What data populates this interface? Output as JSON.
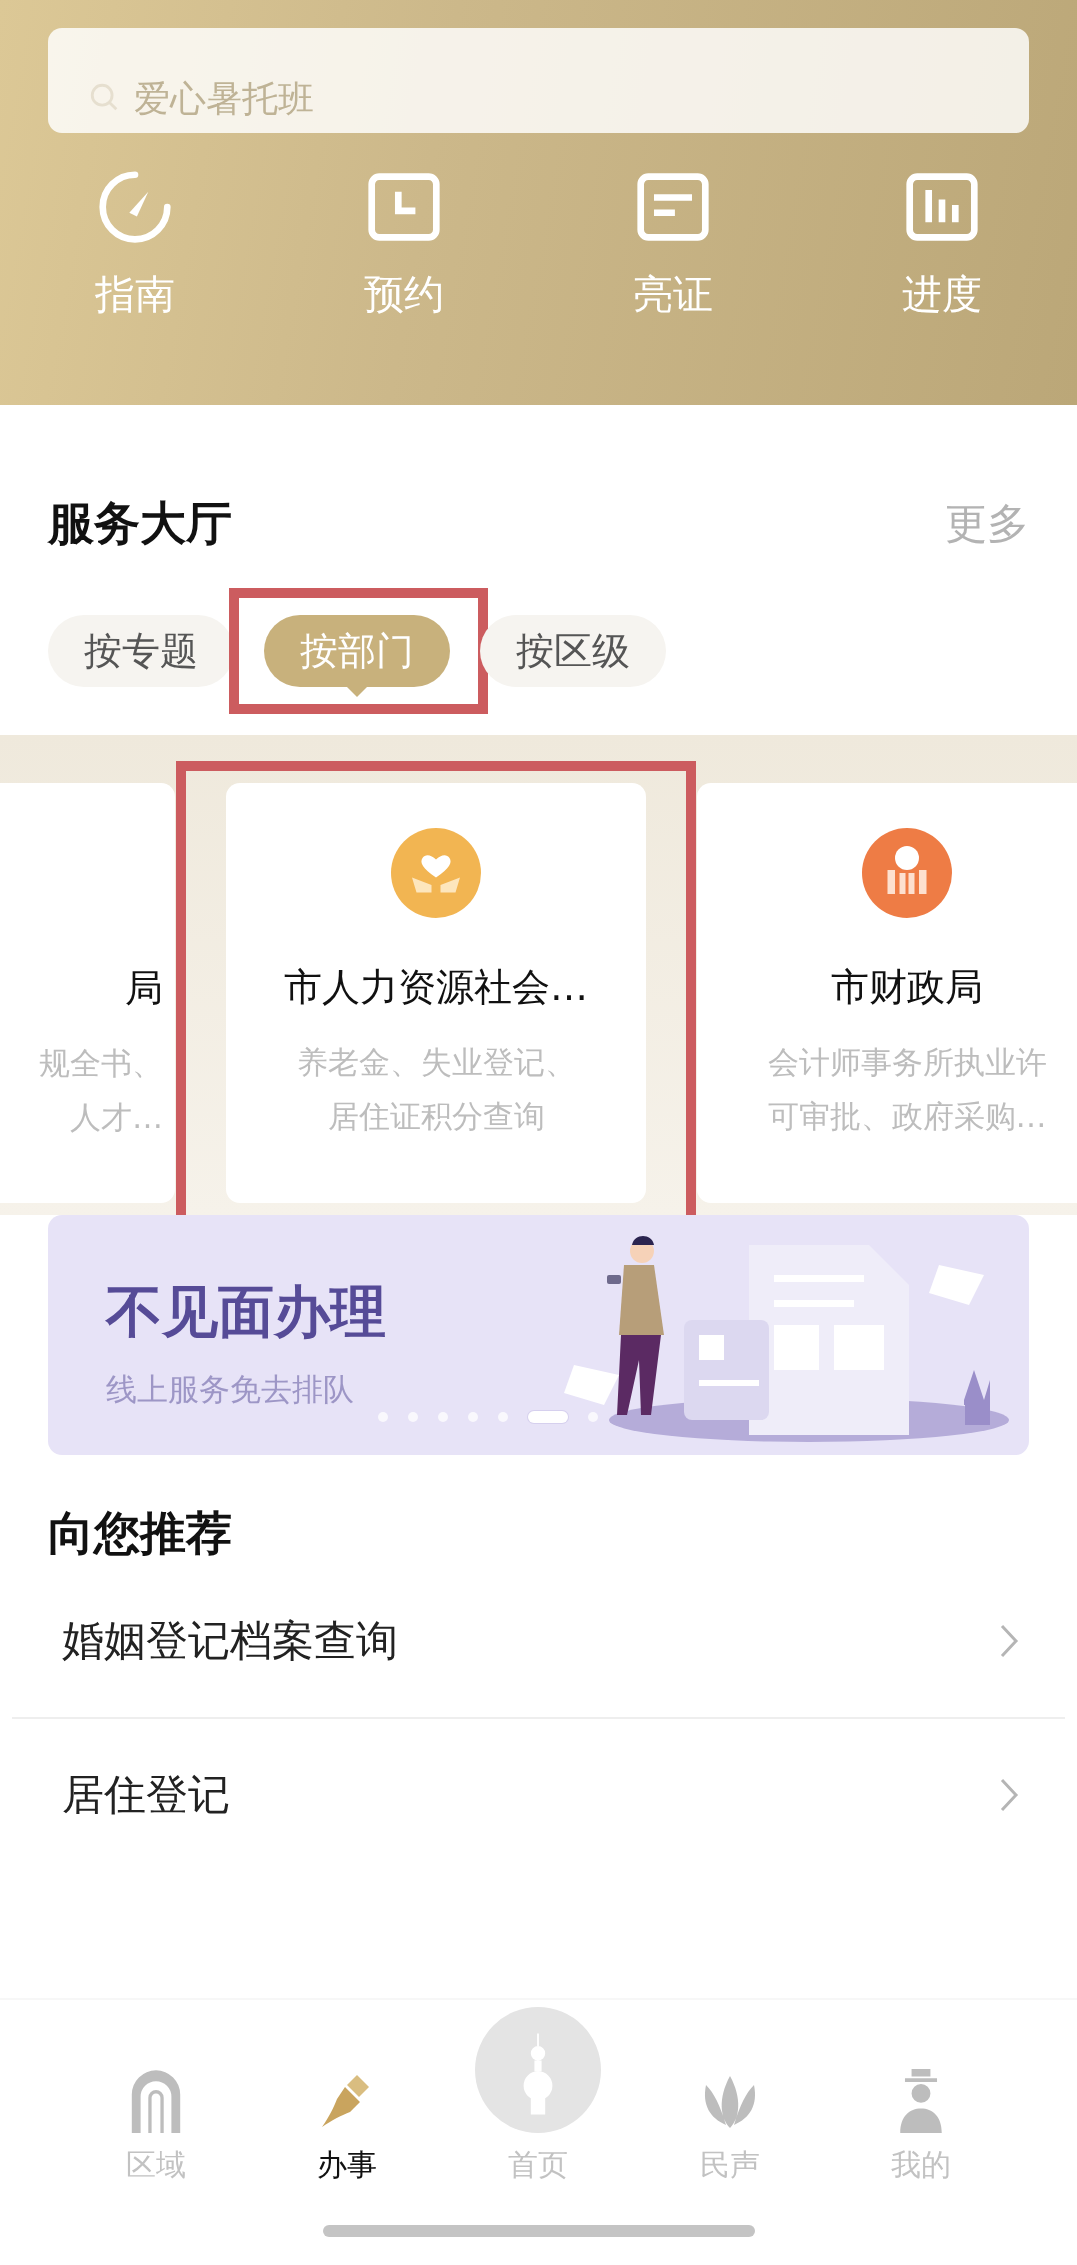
{
  "search": {
    "placeholder": "爱心暑托班"
  },
  "quick_actions": [
    {
      "kind": "gauge",
      "label": "指南"
    },
    {
      "kind": "clock",
      "label": "预约"
    },
    {
      "kind": "card",
      "label": "亮证"
    },
    {
      "kind": "chart",
      "label": "进度"
    }
  ],
  "service_hall": {
    "title": "服务大厅",
    "more": "更多",
    "tabs": [
      {
        "label": "按专题",
        "selected": false,
        "highlighted": false
      },
      {
        "label": "按部门",
        "selected": true,
        "highlighted": true
      },
      {
        "label": "按区级",
        "selected": false,
        "highlighted": false
      }
    ],
    "cards": [
      {
        "kind": "partial",
        "title": "局",
        "desc": [
          "规全书、",
          "人才…"
        ],
        "highlighted": false
      },
      {
        "kind": "heart",
        "title": "市人力资源社会…",
        "desc": [
          "养老金、失业登记、",
          "居住证积分查询"
        ],
        "highlighted": true
      },
      {
        "kind": "money",
        "title": "市财政局",
        "desc": [
          "会计师事务所执业许",
          "可审批、政府采购…"
        ],
        "highlighted": false
      }
    ]
  },
  "banner": {
    "title": "不见面办理",
    "subtitle": "线上服务免去排队",
    "dots": [
      {
        "selected": false
      },
      {
        "selected": false
      },
      {
        "selected": false
      },
      {
        "selected": false
      },
      {
        "selected": false
      },
      {
        "selected": true
      },
      {
        "selected": false
      }
    ]
  },
  "recommend": {
    "title": "向您推荐",
    "items": [
      "婚姻登记档案查询",
      "居住登记"
    ]
  },
  "tab_bar": [
    {
      "kind": "gate",
      "label": "区域",
      "selected": false
    },
    {
      "kind": "pen",
      "label": "办事",
      "selected": true
    },
    {
      "kind": "home",
      "label": "首页",
      "selected": false
    },
    {
      "kind": "flower",
      "label": "民声",
      "selected": false
    },
    {
      "kind": "person",
      "label": "我的",
      "selected": false
    }
  ]
}
